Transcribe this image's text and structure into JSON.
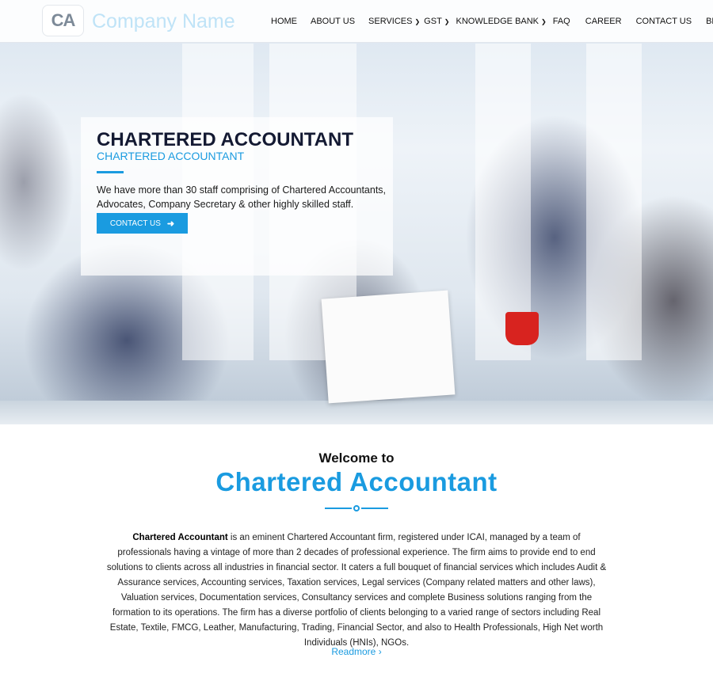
{
  "brand": {
    "logo_text": "CA",
    "company_name": "Company Name"
  },
  "nav": {
    "items": [
      {
        "label": "HOME",
        "dropdown": false
      },
      {
        "label": "ABOUT US",
        "dropdown": false
      },
      {
        "label": "SERVICES",
        "dropdown": true
      },
      {
        "label": "GST",
        "dropdown": true
      },
      {
        "label": "KNOWLEDGE BANK",
        "dropdown": true
      },
      {
        "label": "FAQ",
        "dropdown": false
      },
      {
        "label": "CAREER",
        "dropdown": false
      },
      {
        "label": "CONTACT US",
        "dropdown": false
      },
      {
        "label": "BLOG",
        "dropdown": false
      }
    ]
  },
  "hero": {
    "title": "CHARTERED ACCOUNTANT",
    "subtitle": "CHARTERED ACCOUNTANT",
    "description": "We have more than 30 staff comprising of Chartered Accountants, Advocates, Company Secretary & other highly skilled staff.",
    "button_label": "CONTACT US"
  },
  "welcome": {
    "label": "Welcome to",
    "title": "Chartered Accountant",
    "about_bold": "Chartered Accountant",
    "about_text": " is an eminent Chartered Accountant firm, registered under ICAI, managed by a team of professionals having a vintage of more than 2 decades of professional experience. The firm aims to provide end to end solutions to clients across all industries in financial sector. It caters a full bouquet of financial services which includes Audit & Assurance services, Accounting services, Taxation services, Legal services (Company related matters and other laws), Valuation services, Documentation services, Consultancy services and complete Business solutions ranging from the formation to its operations. The firm has a diverse portfolio of clients belonging to a varied range of sectors including Real Estate, Textile, FMCG, Leather, Manufacturing, Trading, Financial Sector, and also to Health Professionals, High Net worth Individuals (HNIs), NGOs.",
    "readmore_label": "Readmore"
  },
  "colors": {
    "accent": "#1a9be0",
    "heading_dark": "#141a33"
  },
  "icons": {
    "dropdown": "chevron-down-icon",
    "button_arrow": "arrow-right-icon",
    "readmore_arrow": "chevron-right-icon"
  }
}
